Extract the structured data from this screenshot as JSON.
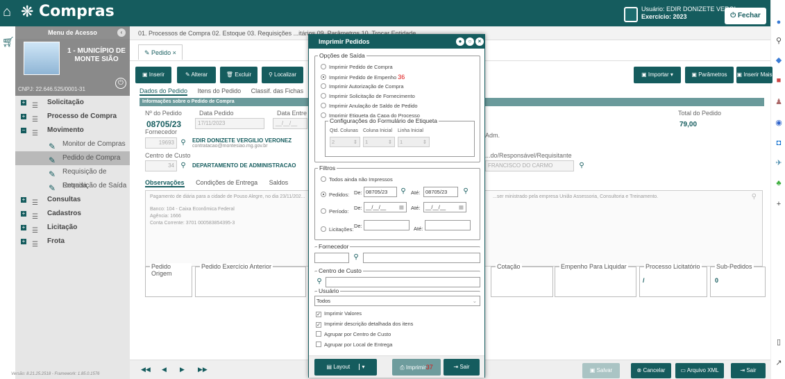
{
  "app": {
    "title": "Compras"
  },
  "user": {
    "label": "Usuário: EDIR DONIZETE VERGI",
    "exercise": "Exercício: 2023",
    "close_label": "Fechar"
  },
  "sidebar": {
    "header": "Menu de Acesso",
    "municipio": "1 - MUNICÍPIO DE MONTE SIÃO",
    "cnpj": "CNPJ: 22.646.525/0001-31",
    "items": [
      {
        "label": "Solicitação"
      },
      {
        "label": "Processo de Compra"
      },
      {
        "label": "Movimento"
      },
      {
        "label": "Consultas"
      },
      {
        "label": "Cadastros"
      },
      {
        "label": "Licitação"
      },
      {
        "label": "Frota"
      }
    ],
    "subitems": [
      {
        "label": "Monitor de Compras"
      },
      {
        "label": "Pedido de Compra"
      },
      {
        "label": "Requisição de Entrada"
      },
      {
        "label": "Requisição de Saída"
      }
    ],
    "version": "Versão: 8.21.25.2518 - Framework: 1.85.0.1576"
  },
  "menubar": {
    "text": "01. Processos de Compra   02. Estoque   03. Requisições                                                                  ...itários   09. Parâmetros   10. Trocar Entidade"
  },
  "tab": {
    "label": "Pedido"
  },
  "toolbar": {
    "inserir": "Inserir",
    "alterar": "Alterar",
    "excluir": "Excluir",
    "localizar": "Localizar",
    "importar": "Importar",
    "parametros": "Parâmetros",
    "inserir_mais": "Inserir Mais"
  },
  "form": {
    "tabs": [
      "Dados do Pedido",
      "Itens do Pedido",
      "Classif. das Fichas"
    ],
    "info_bar": "Informações sobre o Pedido de Compra",
    "num_label": "Nº do Pedido",
    "num_value": "08705/23",
    "data_label": "Data Pedido",
    "data_value": "17/11/2023",
    "entrega_label": "Data Entre",
    "entrega_value": "__/__/__",
    "total_label": "Total do Pedido",
    "total_value": "79,00",
    "fornecedor_label": "Fornecedor",
    "fornecedor_code": "19693",
    "fornecedor_name": "EDIR DONIZETE VERGILIO VERONEZ",
    "fornecedor_email": "contratacao@montesiao.mg.gov.br",
    "adm_label": "Adm.",
    "centro_label": "Centro de Custo",
    "centro_code": "34",
    "centro_name": "DEPARTAMENTO DE ADMINISTRACAO",
    "resp_label": "...do/Responsável/Requisitante",
    "resp_value": "FRANCISCO DO CARMO",
    "obs_tabs": [
      "Observações",
      "Condições de Entrega",
      "Saldos"
    ],
    "obs_text_1": "Pagamento de diária para a cidade de Pouso Alegre, no dia 23/11/202...",
    "obs_text_2": "Banco: 104 - Caixa Econômica Federal",
    "obs_text_3": "Agência: 1666",
    "obs_text_4": "Conta Corrente: 3701 000583854395-3",
    "obs_text_right": "...ser ministrado pela empresa União Assessoria, Consultoria e Treinamento.",
    "groups": {
      "origem": "Pedido Origem",
      "exercicio": "Pedido Exercício Anterior",
      "cotacao": "Cotação",
      "empenho": "Empenho Para Liquidar",
      "processo": "Processo Licitatório",
      "processo_value": "/",
      "sub": "Sub-Pedidos",
      "sub_value": "0"
    }
  },
  "bottombar": {
    "salvar": "Salvar",
    "cancelar": "Cancelar",
    "xml": "Arquivo XML",
    "sair": "Sair"
  },
  "modal": {
    "title": "Imprimir Pedidos",
    "saida_label": "Opções de Saída",
    "options": [
      "Imprimir Pedido de Compra",
      "Imprimir Pedido de Empenho",
      "Imprimir Autorização de Compra",
      "Imprimir Solicitação de Fornecimento",
      "Imprimir Anulação de Saldo de Pedido",
      "Imprimir Etiqueta da Capa do Processo"
    ],
    "annotation_36": "36",
    "etiqueta_label": "Configurações do Formulário de Etiqueta",
    "etq_cols": "Qtd. Colunas",
    "etq_coli": "Coluna Inicial",
    "etq_lini": "Linha Inicial",
    "etq_v1": "2",
    "etq_v2": "1",
    "etq_v3": "1",
    "filtros_label": "Filtros",
    "f_todos": "Todos ainda não Impressos",
    "f_pedidos": "Pedidos:",
    "f_periodo": "Período:",
    "f_licitacoes": "Licitações:",
    "de": "De:",
    "ate": "Até:",
    "ped_de": "08705/23",
    "ped_ate": "08705/23",
    "per_de": "__/__/__",
    "per_ate": "__/__/__",
    "fornecedor_label": "Fornecedor",
    "centro_label": "Centro de Custo",
    "usuario_label": "Usuário",
    "usuario_value": "Todos",
    "checks": [
      {
        "label": "Imprimir Valores",
        "checked": true
      },
      {
        "label": "Imprimir descrição detalhada dos itens",
        "checked": true
      },
      {
        "label": "Agrupar por Centro de Custo",
        "checked": false
      },
      {
        "label": "Agrupar por Local de Entrega",
        "checked": false
      }
    ],
    "layout_label": "Layout",
    "imprimir_label": "Imprimir",
    "annotation_37": "37",
    "sair_label": "Sair"
  },
  "icons": {
    "accent": "#155c5e"
  }
}
